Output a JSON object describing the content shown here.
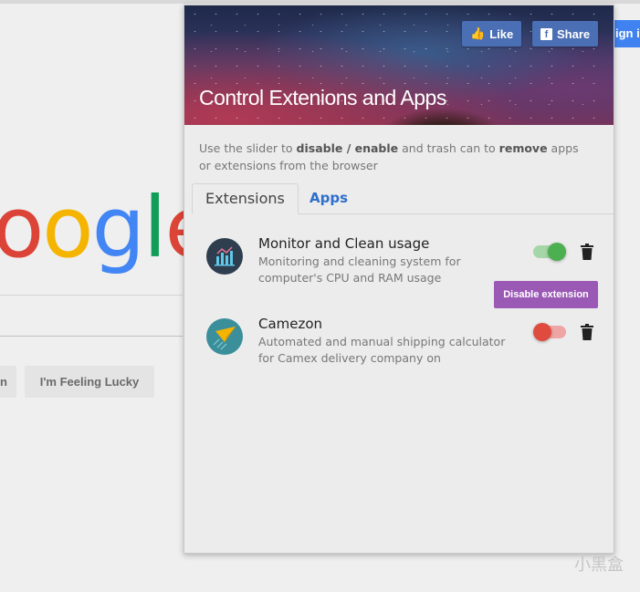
{
  "background_page": {
    "logo_partial": [
      "o",
      "o",
      "g",
      "l",
      "e"
    ],
    "logo_colors": [
      "#db4437",
      "#f4b400",
      "#4285f4",
      "#0f9d58",
      "#db4437"
    ],
    "search_button_partial": "n",
    "lucky_button": "I'm Feeling Lucky",
    "sign_in_partial": "ign i"
  },
  "popup": {
    "title": "Control Extenions and Apps",
    "like_button": "Like",
    "share_button": "Share",
    "description": {
      "p1": "Use the slider to ",
      "b1": "disable / enable",
      "p2": " and trash can to ",
      "b2": "remove",
      "p3": " apps or extensions from the browser"
    },
    "tabs": [
      {
        "label": "Extensions",
        "active": true
      },
      {
        "label": "Apps",
        "active": false
      }
    ],
    "items": [
      {
        "name": "Monitor and Clean usage",
        "description": "Monitoring and cleaning system for computer's CPU and RAM usage",
        "enabled": true,
        "icon": "chart-icon"
      },
      {
        "name": "Camezon",
        "description": "Automated and manual shipping calculator for Camex delivery company on",
        "enabled": false,
        "icon": "paper-plane-icon"
      }
    ],
    "tooltip": "Disable extension"
  },
  "colors": {
    "enabled": "#4caf50",
    "disabled": "#e04b3f",
    "tooltip": "#9b59b6",
    "facebook": "#4a6fb5",
    "apps_tab": "#2f6fcc"
  },
  "watermark": "小黑盒"
}
